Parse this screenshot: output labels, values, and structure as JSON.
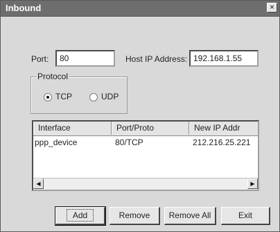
{
  "window": {
    "title": "Inbound",
    "close_glyph": "×"
  },
  "port": {
    "label": "Port:",
    "value": "80"
  },
  "host": {
    "label": "Host IP Address:",
    "value": "192.168.1.55"
  },
  "protocol": {
    "legend": "Protocol",
    "options": [
      {
        "label": "TCP",
        "selected": true
      },
      {
        "label": "UDP",
        "selected": false
      }
    ]
  },
  "table": {
    "columns": [
      "Interface",
      "Port/Proto",
      "New IP Addr"
    ],
    "rows": [
      [
        "ppp_device",
        "80/TCP",
        "212.216.25.221"
      ]
    ],
    "scroll_left_glyph": "◀",
    "scroll_right_glyph": "▶"
  },
  "buttons": {
    "add": "Add",
    "remove": "Remove",
    "remove_all": "Remove All",
    "exit": "Exit"
  }
}
